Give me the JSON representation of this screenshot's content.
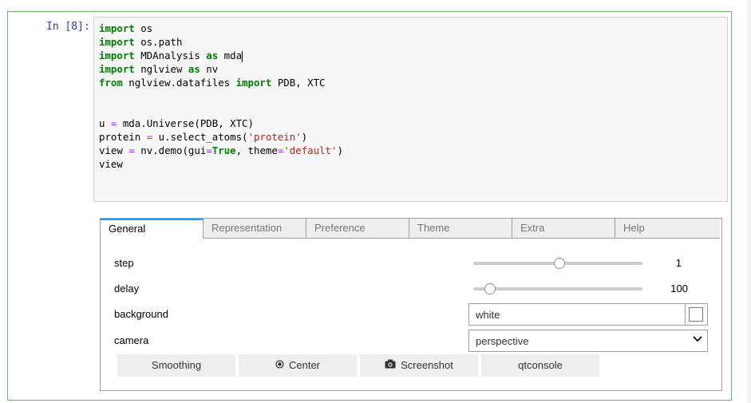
{
  "cell": {
    "prompt": "In [8]:",
    "code_lines": [
      [
        {
          "t": "k",
          "v": "import"
        },
        {
          "t": "n",
          "v": " os"
        }
      ],
      [
        {
          "t": "k",
          "v": "import"
        },
        {
          "t": "n",
          "v": " os.path"
        }
      ],
      [
        {
          "t": "k",
          "v": "import"
        },
        {
          "t": "n",
          "v": " MDAnalysis "
        },
        {
          "t": "k",
          "v": "as"
        },
        {
          "t": "n",
          "v": " mda"
        },
        {
          "t": "cursor",
          "v": ""
        }
      ],
      [
        {
          "t": "k",
          "v": "import"
        },
        {
          "t": "n",
          "v": " nglview "
        },
        {
          "t": "k",
          "v": "as"
        },
        {
          "t": "n",
          "v": " nv"
        }
      ],
      [
        {
          "t": "k",
          "v": "from"
        },
        {
          "t": "n",
          "v": " nglview.datafiles "
        },
        {
          "t": "k",
          "v": "import"
        },
        {
          "t": "n",
          "v": " PDB, XTC"
        }
      ],
      [],
      [],
      [
        {
          "t": "n",
          "v": "u "
        },
        {
          "t": "o",
          "v": "="
        },
        {
          "t": "n",
          "v": " mda.Universe(PDB, XTC)"
        }
      ],
      [
        {
          "t": "n",
          "v": "protein "
        },
        {
          "t": "o",
          "v": "="
        },
        {
          "t": "n",
          "v": " u.select_atoms("
        },
        {
          "t": "s",
          "v": "'protein'"
        },
        {
          "t": "n",
          "v": ")"
        }
      ],
      [
        {
          "t": "n",
          "v": "view "
        },
        {
          "t": "o",
          "v": "="
        },
        {
          "t": "n",
          "v": " nv.demo(gui"
        },
        {
          "t": "o",
          "v": "="
        },
        {
          "t": "k",
          "v": "True"
        },
        {
          "t": "n",
          "v": ", theme"
        },
        {
          "t": "o",
          "v": "="
        },
        {
          "t": "s",
          "v": "'default'"
        },
        {
          "t": "n",
          "v": ")"
        }
      ],
      [
        {
          "t": "n",
          "v": "view"
        }
      ]
    ]
  },
  "widget": {
    "tabs": [
      "General",
      "Representation",
      "Preference",
      "Theme",
      "Extra",
      "Help"
    ],
    "active_tab": "General",
    "step": {
      "label": "step",
      "value": "1",
      "fraction": 0.51
    },
    "delay": {
      "label": "delay",
      "value": "100",
      "fraction": 0.1
    },
    "background": {
      "label": "background",
      "value": "white",
      "color": "#ffffff"
    },
    "camera": {
      "label": "camera",
      "value": "perspective"
    },
    "buttons": {
      "smoothing": "Smoothing",
      "center": "Center",
      "screenshot": "Screenshot",
      "qtconsole": "qtconsole"
    }
  }
}
